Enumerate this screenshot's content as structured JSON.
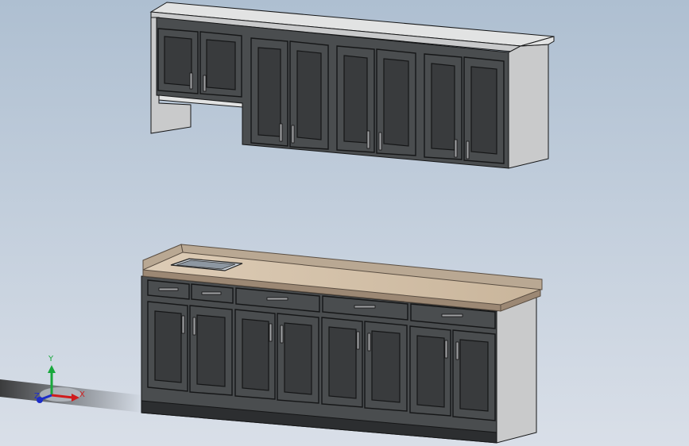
{
  "viewport": {
    "background_top": "#aebfd1",
    "background_bottom": "#d9dfe8"
  },
  "model": {
    "cabinet_color": "#4a4d4f",
    "cabinet_dark": "#2c2e30",
    "cabinet_edge": "#151617",
    "side_panel_color": "#c9cacb",
    "top_panel_color": "#e2e3e3",
    "countertop_color": "#d6c3ab",
    "countertop_edge": "#9c8874",
    "backsplash_color": "#b9a893",
    "sink_color": "#c6cdd4",
    "handle_color": "#9ea0a2"
  },
  "triad": {
    "x_label": "X",
    "y_label": "Y",
    "z_label": "Z",
    "x_color": "#d01c1c",
    "y_color": "#18a83c",
    "z_color": "#1c2cc8"
  }
}
